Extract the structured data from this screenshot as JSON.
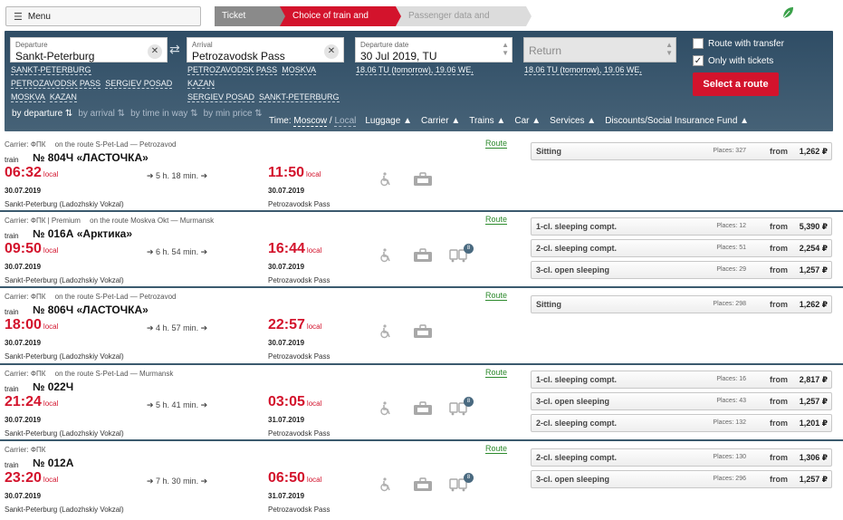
{
  "header": {
    "menu_label": "Menu",
    "steps": [
      "Ticket search",
      "Choice of train and place",
      "Passenger data and payment"
    ]
  },
  "search": {
    "departure_label": "Departure",
    "departure_value": "Sankt-Peterburg",
    "departure_suggestions": [
      "SANKT-PETERBURG",
      "PETROZAVODSK PASS",
      "SERGIEV POSAD",
      "MOSKVA",
      "KAZAN"
    ],
    "arrival_label": "Arrival",
    "arrival_value": "Petrozavodsk Pass",
    "arrival_suggestions": [
      "PETROZAVODSK PASS",
      "MOSKVA",
      "KAZAN",
      "SERGIEV POSAD",
      "SANKT-PETERBURG"
    ],
    "date_label": "Departure date",
    "date_value": "30 Jul 2019, TU",
    "date_suggestions": "18.06 TU (tomorrow), 19.06 WE,",
    "return_placeholder": "Return",
    "return_suggestions": "18.06 TU (tomorrow), 19.06 WE,",
    "transfer_label": "Route with transfer",
    "transfer_checked": false,
    "only_tickets_label": "Only with tickets",
    "only_tickets_checked": true,
    "select_route_label": "Select a route"
  },
  "sort": {
    "by_departure": "by departure",
    "by_arrival": "by arrival",
    "by_time": "by time in way",
    "by_price": "by min price"
  },
  "filters": {
    "time_label": "Time:",
    "time_moscow": "Moscow",
    "time_sep": "/",
    "time_local": "Local",
    "items": [
      "Luggage",
      "Carrier",
      "Trains",
      "Car",
      "Services",
      "Discounts/Social Insurance Fund"
    ]
  },
  "colors": {
    "accent": "#d3132c",
    "panel": "#3b5a6e",
    "link": "#2c8a2c"
  },
  "trains": [
    {
      "carrier": "Carrier: ФПК",
      "route_text": "on the route S-Pet-Lad — Petrozavod",
      "route_link": "Route",
      "type": "train",
      "number": "№ 804Ч «ЛАСТОЧКА»",
      "dep_time": "06:32",
      "dep_local": "local",
      "duration": "5 h. 18 min.",
      "arr_time": "11:50",
      "arr_local": "local",
      "dep_date": "30.07.2019",
      "arr_date": "30.07.2019",
      "dep_station": "Sankt-Peterburg (Ladozhskiy Vokzal)",
      "arr_station": "Petrozavodsk Pass",
      "coach_badge": null,
      "classes": [
        {
          "name": "Sitting",
          "places": "Places: 327",
          "from": "from",
          "price": "1,262 ₽"
        }
      ]
    },
    {
      "carrier": "Carrier: ФПК | Premium",
      "route_text": "on the route Moskva Okt — Murmansk",
      "route_link": "Route",
      "type": "train",
      "number": "№ 016А «Арктика»",
      "dep_time": "09:50",
      "dep_local": "local",
      "duration": "6 h. 54 min.",
      "arr_time": "16:44",
      "arr_local": "local",
      "dep_date": "30.07.2019",
      "arr_date": "30.07.2019",
      "dep_station": "Sankt-Peterburg (Ladozhskiy Vokzal)",
      "arr_station": "Petrozavodsk Pass",
      "coach_badge": "8",
      "classes": [
        {
          "name": "1-cl. sleeping compt.",
          "places": "Places: 12",
          "from": "from",
          "price": "5,390 ₽"
        },
        {
          "name": "2-cl. sleeping compt.",
          "places": "Places: 51",
          "from": "from",
          "price": "2,254 ₽"
        },
        {
          "name": "3-cl. open sleeping",
          "places": "Places: 29",
          "from": "from",
          "price": "1,257 ₽"
        }
      ]
    },
    {
      "carrier": "Carrier: ФПК",
      "route_text": "on the route S-Pet-Lad — Petrozavod",
      "route_link": "Route",
      "type": "train",
      "number": "№ 806Ч «ЛАСТОЧКА»",
      "dep_time": "18:00",
      "dep_local": "local",
      "duration": "4 h. 57 min.",
      "arr_time": "22:57",
      "arr_local": "local",
      "dep_date": "30.07.2019",
      "arr_date": "30.07.2019",
      "dep_station": "Sankt-Peterburg (Ladozhskiy Vokzal)",
      "arr_station": "Petrozavodsk Pass",
      "coach_badge": null,
      "classes": [
        {
          "name": "Sitting",
          "places": "Places: 298",
          "from": "from",
          "price": "1,262 ₽"
        }
      ]
    },
    {
      "carrier": "Carrier: ФПК",
      "route_text": "on the route S-Pet-Lad — Murmansk",
      "route_link": "Route",
      "type": "train",
      "number": "№ 022Ч",
      "dep_time": "21:24",
      "dep_local": "local",
      "duration": "5 h. 41 min.",
      "arr_time": "03:05",
      "arr_local": "local",
      "dep_date": "30.07.2019",
      "arr_date": "31.07.2019",
      "dep_station": "Sankt-Peterburg (Ladozhskiy Vokzal)",
      "arr_station": "Petrozavodsk Pass",
      "coach_badge": "8",
      "classes": [
        {
          "name": "1-cl. sleeping compt.",
          "places": "Places: 16",
          "from": "from",
          "price": "2,817 ₽"
        },
        {
          "name": "3-cl. open sleeping",
          "places": "Places: 43",
          "from": "from",
          "price": "1,257 ₽"
        },
        {
          "name": "2-cl. sleeping compt.",
          "places": "Places: 132",
          "from": "from",
          "price": "1,201 ₽"
        }
      ]
    },
    {
      "carrier": "Carrier: ФПК",
      "route_text": "",
      "route_link": "Route",
      "type": "train",
      "number": "№ 012А",
      "dep_time": "23:20",
      "dep_local": "local",
      "duration": "7 h. 30 min.",
      "arr_time": "06:50",
      "arr_local": "local",
      "dep_date": "30.07.2019",
      "arr_date": "31.07.2019",
      "dep_station": "Sankt-Peterburg (Ladozhskiy Vokzal)",
      "arr_station": "Petrozavodsk Pass",
      "coach_badge": "8",
      "classes": [
        {
          "name": "2-cl. sleeping compt.",
          "places": "Places: 130",
          "from": "from",
          "price": "1,306 ₽"
        },
        {
          "name": "3-cl. open sleeping",
          "places": "Places: 296",
          "from": "from",
          "price": "1,257 ₽"
        }
      ]
    }
  ]
}
